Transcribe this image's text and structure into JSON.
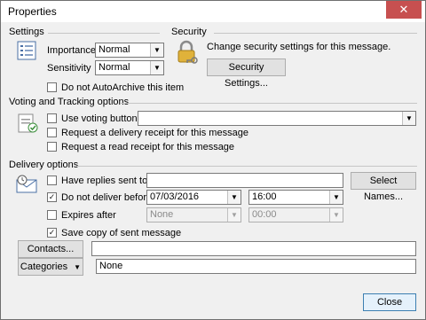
{
  "window": {
    "title": "Properties",
    "close_glyph": "✕"
  },
  "settings": {
    "section_title": "Settings",
    "importance_label": "Importance",
    "importance_value": "Normal",
    "sensitivity_label": "Sensitivity",
    "sensitivity_value": "Normal",
    "autoarchive_label": "Do not AutoArchive this item",
    "autoarchive_checked": false
  },
  "security": {
    "section_title": "Security",
    "description": "Change security settings for this message.",
    "button_label": "Security Settings..."
  },
  "voting": {
    "section_title": "Voting and Tracking options",
    "use_voting_label": "Use voting buttons",
    "use_voting_checked": false,
    "voting_value": "",
    "delivery_receipt_label": "Request a delivery receipt for this message",
    "read_receipt_label": "Request a read receipt for this message"
  },
  "delivery": {
    "section_title": "Delivery options",
    "have_replies_label": "Have replies sent to",
    "have_replies_value": "",
    "select_names_label": "Select Names...",
    "do_not_deliver_label": "Do not deliver before",
    "do_not_deliver_checked": true,
    "deliver_date": "07/03/2016",
    "deliver_time": "16:00",
    "expires_label": "Expires after",
    "expires_date": "None",
    "expires_time": "00:00",
    "save_copy_label": "Save copy of sent message",
    "save_copy_checked": true
  },
  "contacts": {
    "button_label": "Contacts...",
    "value": ""
  },
  "categories": {
    "button_label": "Categories",
    "value": "None"
  },
  "footer": {
    "close_label": "Close"
  },
  "icons": {
    "dropdown": "▼",
    "checkmark": "✓"
  }
}
